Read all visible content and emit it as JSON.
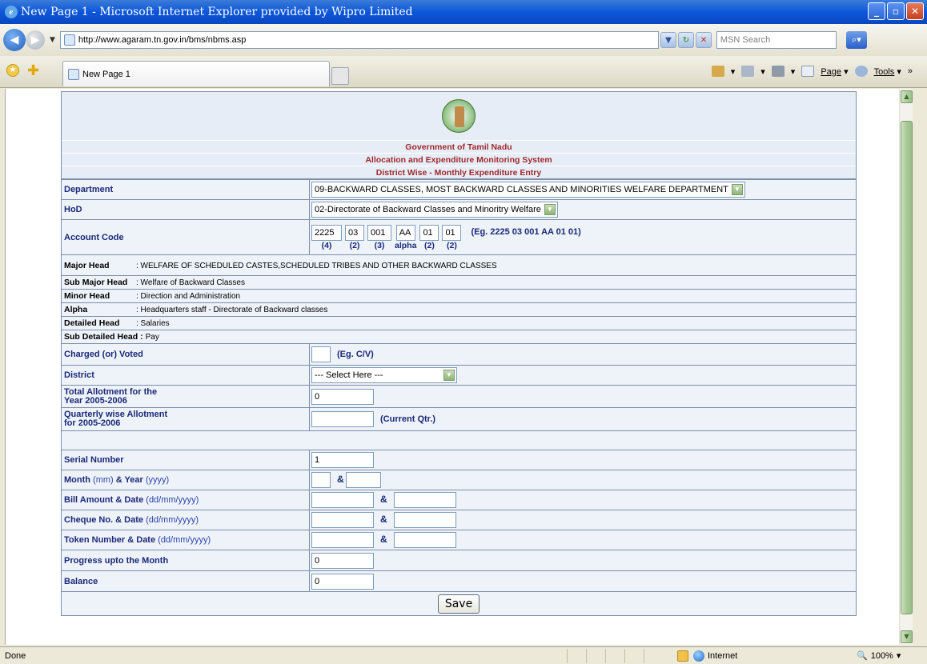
{
  "window": {
    "title": "New Page 1 - Microsoft Internet Explorer provided by Wipro Limited"
  },
  "address": {
    "url": "http://www.agaram.tn.gov.in/bms/nbms.asp",
    "search_placeholder": "MSN Search"
  },
  "tabs": [
    {
      "label": "New Page 1"
    }
  ],
  "toolbar": {
    "page_label": "Page",
    "tools_label": "Tools"
  },
  "header": {
    "line1": "Government of Tamil Nadu",
    "line2": "Allocation and Expenditure Monitoring System",
    "line3": "District Wise - Monthly Expenditure Entry"
  },
  "form": {
    "department": {
      "label": "Department",
      "value": "09-BACKWARD CLASSES, MOST BACKWARD CLASSES AND MINORITIES WELFARE DEPARTMENT"
    },
    "hod": {
      "label": "HoD",
      "value": "02-Directorate of Backward Classes and Minoritry Welfare"
    },
    "account_code": {
      "label": "Account Code",
      "fields": [
        "2225",
        "03",
        "001",
        "AA",
        "01",
        "01"
      ],
      "subs": [
        "(4)",
        "(2)",
        "(3)",
        "alpha",
        "(2)",
        "(2)"
      ],
      "example": "(Eg. 2225 03 001 AA 01 01)"
    },
    "heads": [
      {
        "label": "Major Head",
        "value": ": WELFARE OF SCHEDULED CASTES,SCHEDULED TRIBES AND OTHER BACKWARD CLASSES"
      },
      {
        "label": "Sub Major Head",
        "value": ": Welfare of Backward Classes"
      },
      {
        "label": "Minor Head",
        "value": ": Direction and Administration"
      },
      {
        "label": "Alpha",
        "value": ": Headquarters staff - Directorate of Backward classes"
      },
      {
        "label": "Detailed Head",
        "value": ": Salaries"
      },
      {
        "label": "Sub Detailed Head :",
        "value": "Pay"
      }
    ],
    "charged": {
      "label": "Charged (or) Voted",
      "value": "",
      "example": "(Eg. C/V)"
    },
    "district": {
      "label": "District",
      "value": "--- Select Here ---"
    },
    "total_allotment": {
      "label_l1": "Total Allotment for the",
      "label_l2": "Year 2005-2006",
      "value": "0"
    },
    "quarterly": {
      "label_l1": "Quarterly wise Allotment",
      "label_l2": "for 2005-2006",
      "value": "",
      "note": "(Current Qtr.)"
    },
    "serial": {
      "label": "Serial Number",
      "value": "1"
    },
    "month_year": {
      "label_a": "Month",
      "hint_a": " (mm)",
      "label_b": " & Year",
      "hint_b": " (yyyy)",
      "sep": "&"
    },
    "bill": {
      "label": "Bill  Amount & Date",
      "hint": " (dd/mm/yyyy)",
      "sep": "&"
    },
    "cheque": {
      "label": "Cheque No. & Date",
      "hint": " (dd/mm/yyyy)",
      "sep": "&"
    },
    "token": {
      "label": "Token Number & Date",
      "hint": " (dd/mm/yyyy)",
      "sep": "&"
    },
    "progress": {
      "label": "Progress upto the Month",
      "value": "0"
    },
    "balance": {
      "label": "Balance",
      "value": "0"
    },
    "save_label": "Save"
  },
  "status": {
    "text": "Done",
    "zone": "Internet",
    "zoom": "100%"
  }
}
